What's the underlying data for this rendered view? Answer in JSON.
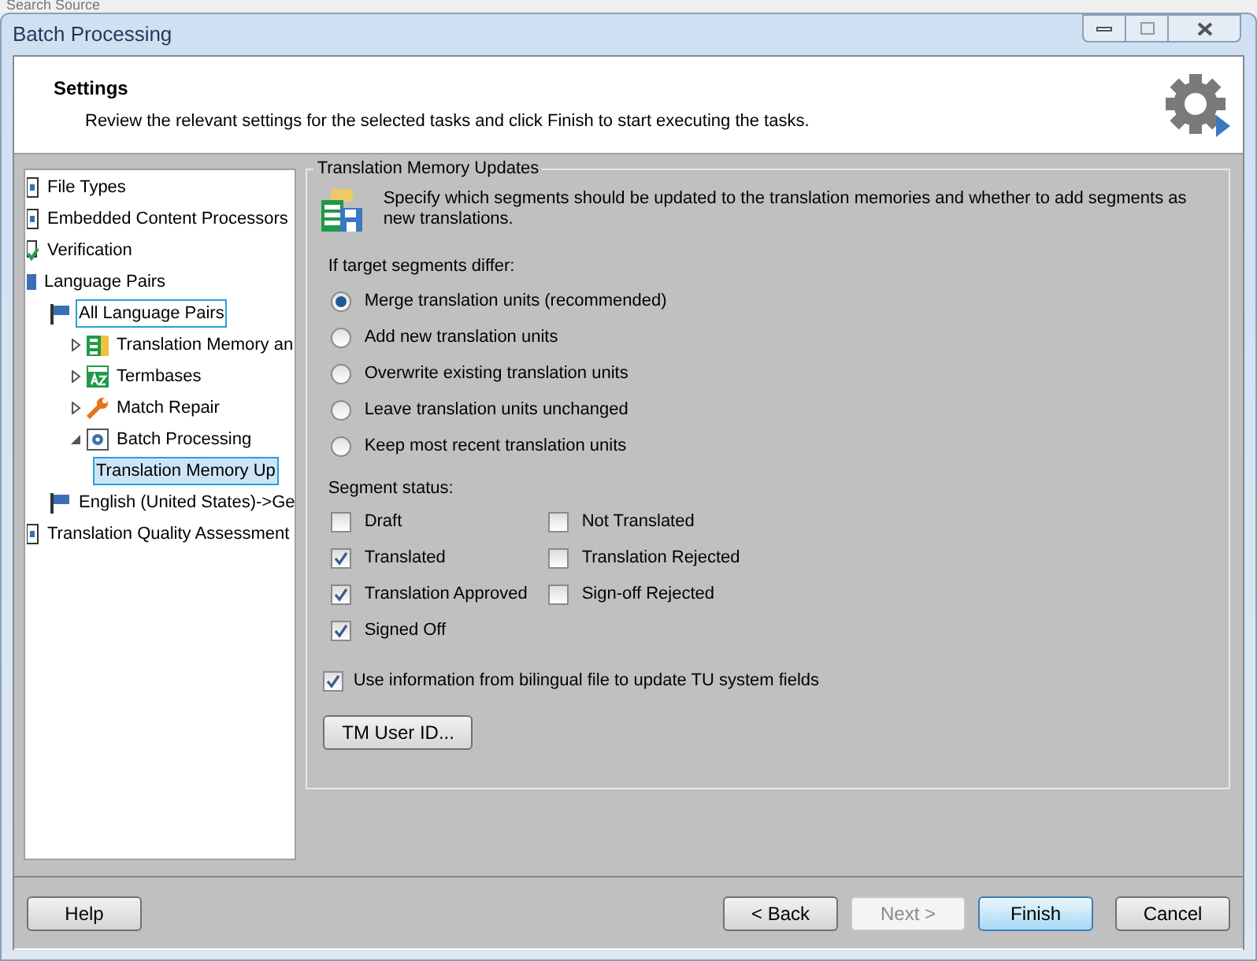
{
  "background_toolbar": {
    "label": "Search Source"
  },
  "window": {
    "title": "Batch Processing"
  },
  "header": {
    "title": "Settings",
    "description": "Review the relevant settings for the selected tasks and click Finish to start executing the tasks."
  },
  "tree": [
    {
      "label": "File Types",
      "kind": "document",
      "selected": false,
      "focused": false
    },
    {
      "label": "Embedded Content Processors",
      "kind": "document",
      "selected": false,
      "focused": false
    },
    {
      "label": "Verification",
      "kind": "check",
      "selected": false,
      "focused": false
    },
    {
      "label": "Language Pairs",
      "kind": "folder",
      "selected": false,
      "focused": false,
      "children": [
        {
          "label": "All Language Pairs",
          "kind": "flag",
          "selected": false,
          "focused": true,
          "children": [
            {
              "label": "Translation Memory an",
              "kind": "tm",
              "selected": false,
              "focused": false,
              "expanded": false
            },
            {
              "label": "Termbases",
              "kind": "termbase",
              "selected": false,
              "focused": false,
              "expanded": false
            },
            {
              "label": "Match Repair",
              "kind": "wrench",
              "selected": false,
              "focused": false,
              "expanded": false
            },
            {
              "label": "Batch Processing",
              "kind": "gear",
              "selected": false,
              "focused": false,
              "expanded": true,
              "children": [
                {
                  "label": "Translation Memory Up",
                  "selected": true,
                  "focused": true
                }
              ]
            }
          ]
        },
        {
          "label": "English (United States)->Ge",
          "kind": "flag",
          "selected": false,
          "focused": false
        }
      ]
    },
    {
      "label": "Translation Quality Assessment",
      "kind": "document",
      "selected": false,
      "focused": false
    }
  ],
  "group": {
    "title": "Translation Memory Updates",
    "description": "Specify which segments should be updated to the translation memories and whether to add segments as new translations.",
    "differ_label": "If target segments differ:",
    "options": [
      {
        "label": "Merge translation units (recommended)",
        "selected": true
      },
      {
        "label": "Add new translation units",
        "selected": false
      },
      {
        "label": "Overwrite existing translation units",
        "selected": false
      },
      {
        "label": "Leave translation units unchanged",
        "selected": false
      },
      {
        "label": "Keep most recent translation units",
        "selected": false
      }
    ],
    "status_label": "Segment status:",
    "statuses_left": [
      {
        "label": "Draft",
        "checked": false
      },
      {
        "label": "Translated",
        "checked": true
      },
      {
        "label": "Translation Approved",
        "checked": true
      },
      {
        "label": "Signed Off",
        "checked": true
      }
    ],
    "statuses_right": [
      {
        "label": "Not Translated",
        "checked": false
      },
      {
        "label": "Translation Rejected",
        "checked": false
      },
      {
        "label": "Sign-off Rejected",
        "checked": false
      }
    ],
    "use_info": {
      "label": "Use information from bilingual file to update TU system fields",
      "checked": true
    },
    "button": "TM User ID..."
  },
  "footer": {
    "help": "Help",
    "back": "< Back",
    "next": {
      "label": "Next >",
      "disabled": true
    },
    "finish": {
      "label": "Finish",
      "default": true
    },
    "cancel": "Cancel"
  }
}
